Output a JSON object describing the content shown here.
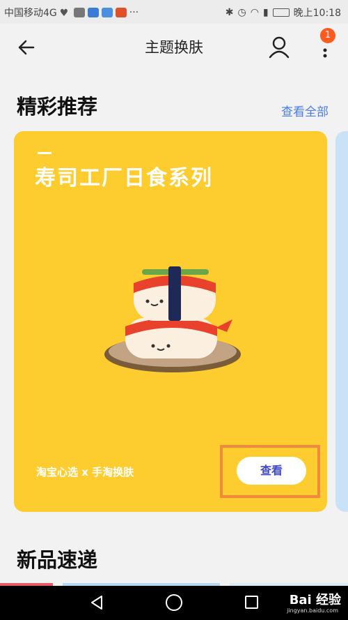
{
  "status_bar": {
    "carrier": "中国移动4G",
    "more": "···",
    "time": "晚上10:18"
  },
  "header": {
    "title": "主题换肤",
    "notification_count": "1"
  },
  "featured": {
    "title": "精彩推荐",
    "see_all": "查看全部",
    "card": {
      "title": "寿司工厂日食系列",
      "subtitle": "淘宝心选 x 手淘换肤",
      "button": "查看",
      "background": "#fdcc2f"
    }
  },
  "new_arrivals": {
    "title": "新品速递"
  },
  "watermark": {
    "logo": "Bai 经验",
    "url": "jingyan.baidu.com"
  },
  "colors": {
    "accent": "#4a7cf0",
    "badge": "#ff5a1f",
    "highlight": "#f08a3c",
    "button_text": "#3f49c9"
  }
}
